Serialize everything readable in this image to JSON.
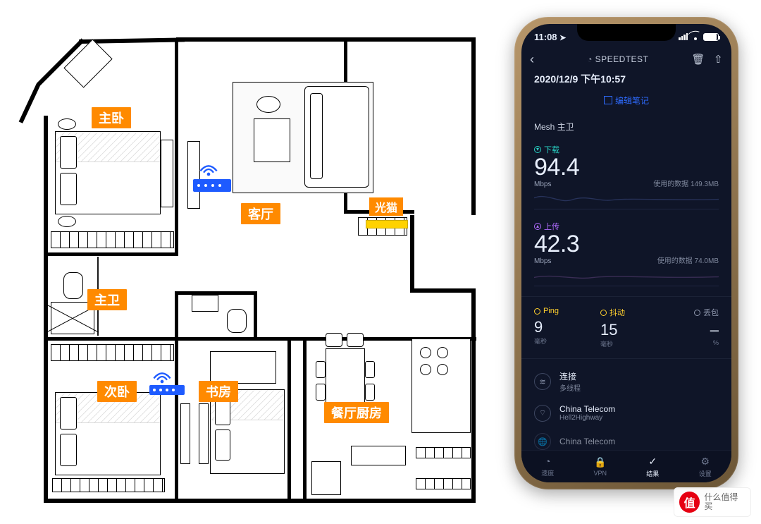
{
  "floorplan": {
    "labels": {
      "master_bedroom": "主卧",
      "living_room": "客厅",
      "modem": "光猫",
      "master_bath": "主卫",
      "second_bedroom": "次卧",
      "study": "书房",
      "kitchen_dining": "餐厅厨房"
    }
  },
  "phone": {
    "status": {
      "clock": "11:08"
    },
    "nav": {
      "title": "SPEEDTEST",
      "back_icon": "‹",
      "trash_icon": "🗑",
      "share_icon": "⇧"
    },
    "timestamp": "2020/12/9 下午10:57",
    "edit_note": "编辑笔记",
    "network_name": "Mesh 主卫",
    "download": {
      "label": "下载",
      "value": "94.4",
      "unit": "Mbps",
      "data_used_label": "使用的数据",
      "data_used_value": "149.3MB"
    },
    "upload": {
      "label": "上传",
      "value": "42.3",
      "unit": "Mbps",
      "data_used_label": "使用的数据",
      "data_used_value": "74.0MB"
    },
    "ping": {
      "label": "Ping",
      "value": "9",
      "unit": "毫秒"
    },
    "jitter": {
      "label": "抖动",
      "value": "15",
      "unit": "毫秒"
    },
    "loss": {
      "label": "丢包",
      "value": "–",
      "unit": "%"
    },
    "connection": {
      "label": "连接",
      "detail": "多线程"
    },
    "isp1": {
      "label": "China Telecom",
      "detail": "Hell2Highway"
    },
    "isp2": {
      "label": "China Telecom"
    },
    "tabs": {
      "speed": "速度",
      "vpn": "VPN",
      "results": "结果",
      "settings": "设置"
    }
  },
  "watermark": {
    "logo_text": "值",
    "text": "什么值得买"
  },
  "chart_data": [
    {
      "type": "line",
      "title": "下载",
      "ylabel": "Mbps",
      "series": [
        {
          "name": "download",
          "values": [
            88,
            104,
            90,
            96,
            93,
            97,
            92,
            95,
            94,
            94,
            94,
            95
          ]
        }
      ],
      "ylim": [
        0,
        150
      ],
      "summary_value": 94.4,
      "data_used_mb": 149.3
    },
    {
      "type": "line",
      "title": "上传",
      "ylabel": "Mbps",
      "series": [
        {
          "name": "upload",
          "values": [
            40,
            44,
            41,
            43,
            42,
            43,
            42,
            42,
            42,
            42,
            42,
            42
          ]
        }
      ],
      "ylim": [
        0,
        100
      ],
      "summary_value": 42.3,
      "data_used_mb": 74.0
    }
  ]
}
